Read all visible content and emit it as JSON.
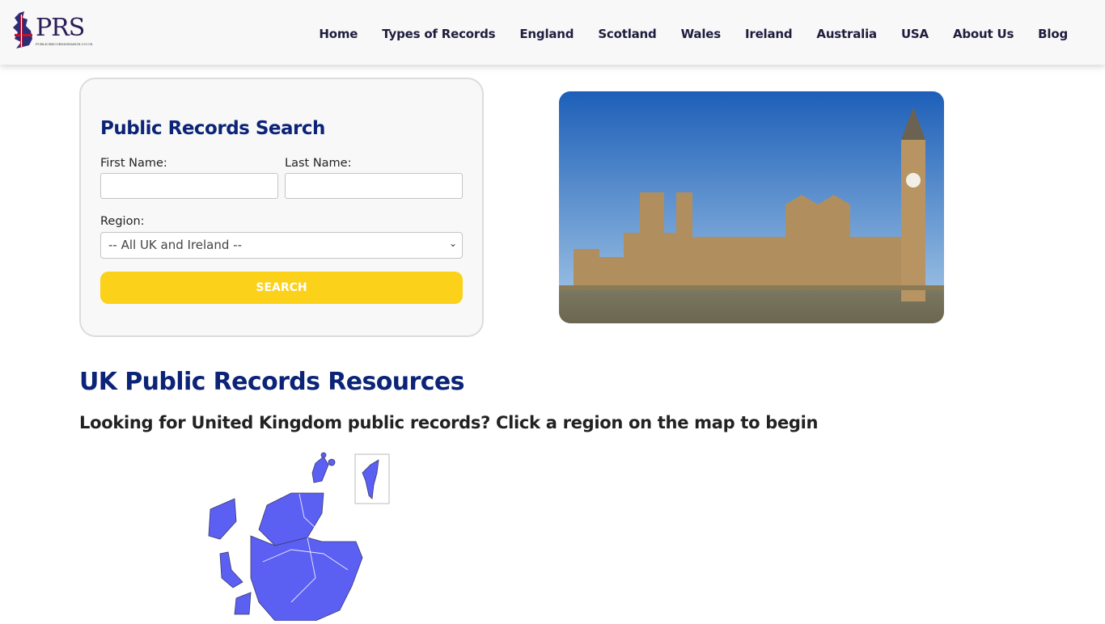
{
  "header": {
    "logo_text": "PRS",
    "logo_subtext": "PUBLICRECORDSSEARCH.CO.UK",
    "nav": [
      "Home",
      "Types of Records",
      "England",
      "Scotland",
      "Wales",
      "Ireland",
      "Australia",
      "USA",
      "About Us",
      "Blog"
    ]
  },
  "search": {
    "title": "Public Records Search",
    "first_name_label": "First Name:",
    "first_name_value": "",
    "last_name_label": "Last Name:",
    "last_name_value": "",
    "region_label": "Region:",
    "region_selected": "-- All UK and Ireland --",
    "button_label": "SEARCH"
  },
  "hero_image": {
    "description": "Houses of Parliament and Big Ben, London"
  },
  "resources": {
    "title": "UK Public Records Resources",
    "subtitle": "Looking for United Kingdom public records? Click a region on the map to begin"
  },
  "map": {
    "region_color": "#5b5ff2",
    "inset": "Shetland Islands"
  },
  "colors": {
    "brand_navy": "#0c2477",
    "button_yellow": "#fbd11a",
    "nav_text": "#1f1d3d"
  }
}
